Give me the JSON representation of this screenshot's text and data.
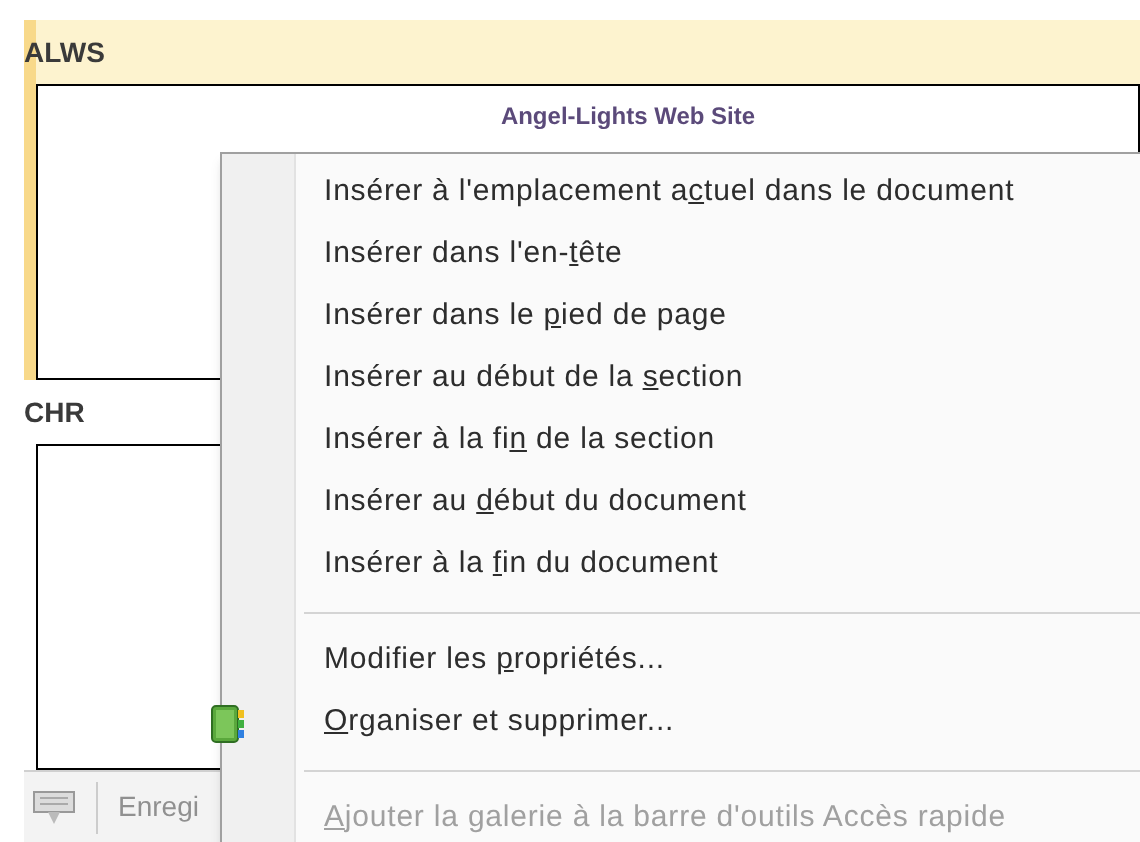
{
  "sections": [
    {
      "title": "ALWS",
      "content": "Angel-Lights Web Site",
      "selected": true
    },
    {
      "title": "CHR",
      "selected": false
    }
  ],
  "status_bar": {
    "text": "Enregi"
  },
  "context_menu": [
    {
      "kind": "item",
      "parts": [
        "Insérer à l'emplacement a",
        "c",
        "tuel dans le document"
      ],
      "disabled": false
    },
    {
      "kind": "item",
      "parts": [
        "Insérer dans l'en-",
        "t",
        "ête"
      ],
      "disabled": false
    },
    {
      "kind": "item",
      "parts": [
        "Insérer dans le ",
        "p",
        "ied de page"
      ],
      "disabled": false
    },
    {
      "kind": "item",
      "parts": [
        "Insérer au début de la ",
        "s",
        "ection"
      ],
      "disabled": false
    },
    {
      "kind": "item",
      "parts": [
        "Insérer à la fi",
        "n",
        " de la section"
      ],
      "disabled": false
    },
    {
      "kind": "item",
      "parts": [
        "Insérer au ",
        "d",
        "ébut du document"
      ],
      "disabled": false
    },
    {
      "kind": "item",
      "parts": [
        "Insérer à la ",
        "f",
        "in du document"
      ],
      "disabled": false
    },
    {
      "kind": "separator"
    },
    {
      "kind": "item",
      "parts": [
        "Modifier les ",
        "p",
        "ropriétés..."
      ],
      "disabled": false
    },
    {
      "kind": "icon_item",
      "parts": [
        "O",
        "rganiser et supprimer..."
      ],
      "disabled": false
    },
    {
      "kind": "separator"
    },
    {
      "kind": "key_first",
      "parts": [
        "A",
        "jouter la galerie à la barre d'outils Accès rapide"
      ],
      "disabled": true
    }
  ]
}
